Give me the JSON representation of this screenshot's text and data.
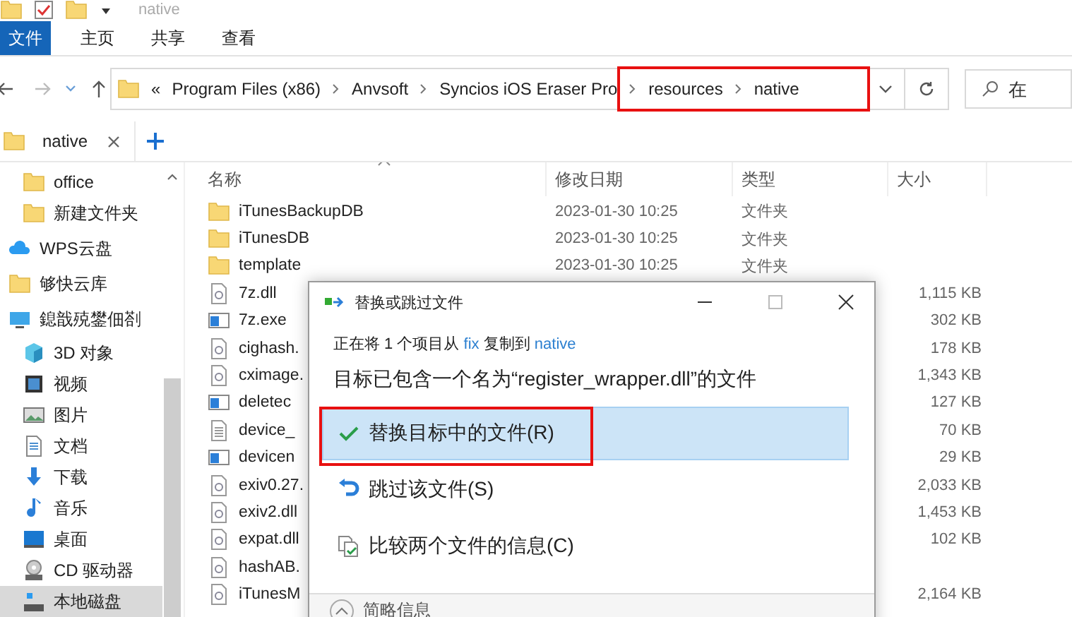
{
  "window": {
    "title": "native"
  },
  "ribbon_tabs": [
    {
      "label": "文件",
      "selected": true
    },
    {
      "label": "主页",
      "selected": false
    },
    {
      "label": "共享",
      "selected": false
    },
    {
      "label": "查看",
      "selected": false
    }
  ],
  "address_bar": {
    "overflow": "«",
    "breadcrumbs": [
      {
        "label": "Program Files (x86)",
        "highlighted": false
      },
      {
        "label": "Anvsoft",
        "highlighted": false
      },
      {
        "label": "Syncios iOS Eraser Pro",
        "highlighted": false
      },
      {
        "label": "resources",
        "highlighted": true
      },
      {
        "label": "native",
        "highlighted": true
      }
    ]
  },
  "search": {
    "placeholder": "在"
  },
  "tabs": [
    {
      "label": "native",
      "selected": true
    }
  ],
  "sidebar": {
    "continued_items": [
      {
        "label": "office",
        "kind": "folder",
        "selected": false
      },
      {
        "label": "新建文件夹",
        "kind": "folder",
        "selected": false
      }
    ],
    "items": [
      {
        "label": "WPS云盘",
        "kind": "cloud",
        "selected": false
      },
      {
        "label": "够快云库",
        "kind": "folder",
        "selected": false
      },
      {
        "label": "鎴戠殑鐢佃剳",
        "kind": "computer",
        "selected": false,
        "children": [
          {
            "label": "3D 对象",
            "kind": "cube",
            "selected": false
          },
          {
            "label": "视频",
            "kind": "video",
            "selected": false
          },
          {
            "label": "图片",
            "kind": "picture",
            "selected": false
          },
          {
            "label": "文档",
            "kind": "document",
            "selected": false
          },
          {
            "label": "下载",
            "kind": "download",
            "selected": false
          },
          {
            "label": "音乐",
            "kind": "music",
            "selected": false
          },
          {
            "label": "桌面",
            "kind": "desktop",
            "selected": false
          },
          {
            "label": "CD 驱动器",
            "kind": "cd",
            "selected": false
          },
          {
            "label": "本地磁盘",
            "kind": "disk",
            "selected": true
          }
        ]
      }
    ]
  },
  "file_table": {
    "columns": [
      "名称",
      "修改日期",
      "类型",
      "大小"
    ],
    "rows": [
      {
        "kind": "folder",
        "name": "iTunesBackupDB",
        "modified": "2023-01-30 10:25",
        "type": "文件夹"
      },
      {
        "kind": "folder",
        "name": "iTunesDB",
        "modified": "2023-01-30 10:25",
        "type": "文件夹"
      },
      {
        "kind": "folder",
        "name": "template",
        "modified": "2023-01-30 10:25",
        "type": "文件夹"
      },
      {
        "kind": "dll",
        "name": "7z.dll",
        "size": "1,115 KB"
      },
      {
        "kind": "exe",
        "name": "7z.exe",
        "size": "302 KB"
      },
      {
        "kind": "dll",
        "name": "cighash.",
        "size": "178 KB"
      },
      {
        "kind": "dll",
        "name": "cximage.",
        "size": "1,343 KB"
      },
      {
        "kind": "exe",
        "name": "deletec",
        "size": "127 KB"
      },
      {
        "kind": "text",
        "name": "device_",
        "size": "70 KB"
      },
      {
        "kind": "exe",
        "name": "devicen",
        "size": "29 KB"
      },
      {
        "kind": "dll",
        "name": "exiv0.27.",
        "size": "2,033 KB"
      },
      {
        "kind": "dll",
        "name": "exiv2.dll",
        "size": "1,453 KB"
      },
      {
        "kind": "dll",
        "name": "expat.dll",
        "size": "102 KB"
      },
      {
        "kind": "dll",
        "name": "hashAB."
      },
      {
        "kind": "dll",
        "name": "iTunesM",
        "size": "2,164 KB"
      }
    ]
  },
  "dialog": {
    "title": "替换或跳过文件",
    "progress": {
      "before": "正在将 1 个项目从",
      "source": "fix",
      "middle": "复制到",
      "target": "native"
    },
    "heading": "目标已包含一个名为“register_wrapper.dll”的文件",
    "options": [
      {
        "kind": "replace",
        "label": "替换目标中的文件(R)",
        "selected": true,
        "highlighted": true
      },
      {
        "kind": "skip",
        "label": "跳过该文件(S)",
        "selected": false,
        "highlighted": false
      },
      {
        "kind": "compare",
        "label": "比较两个文件的信息(C)",
        "selected": false,
        "highlighted": false
      }
    ],
    "footer": "简略信息"
  }
}
